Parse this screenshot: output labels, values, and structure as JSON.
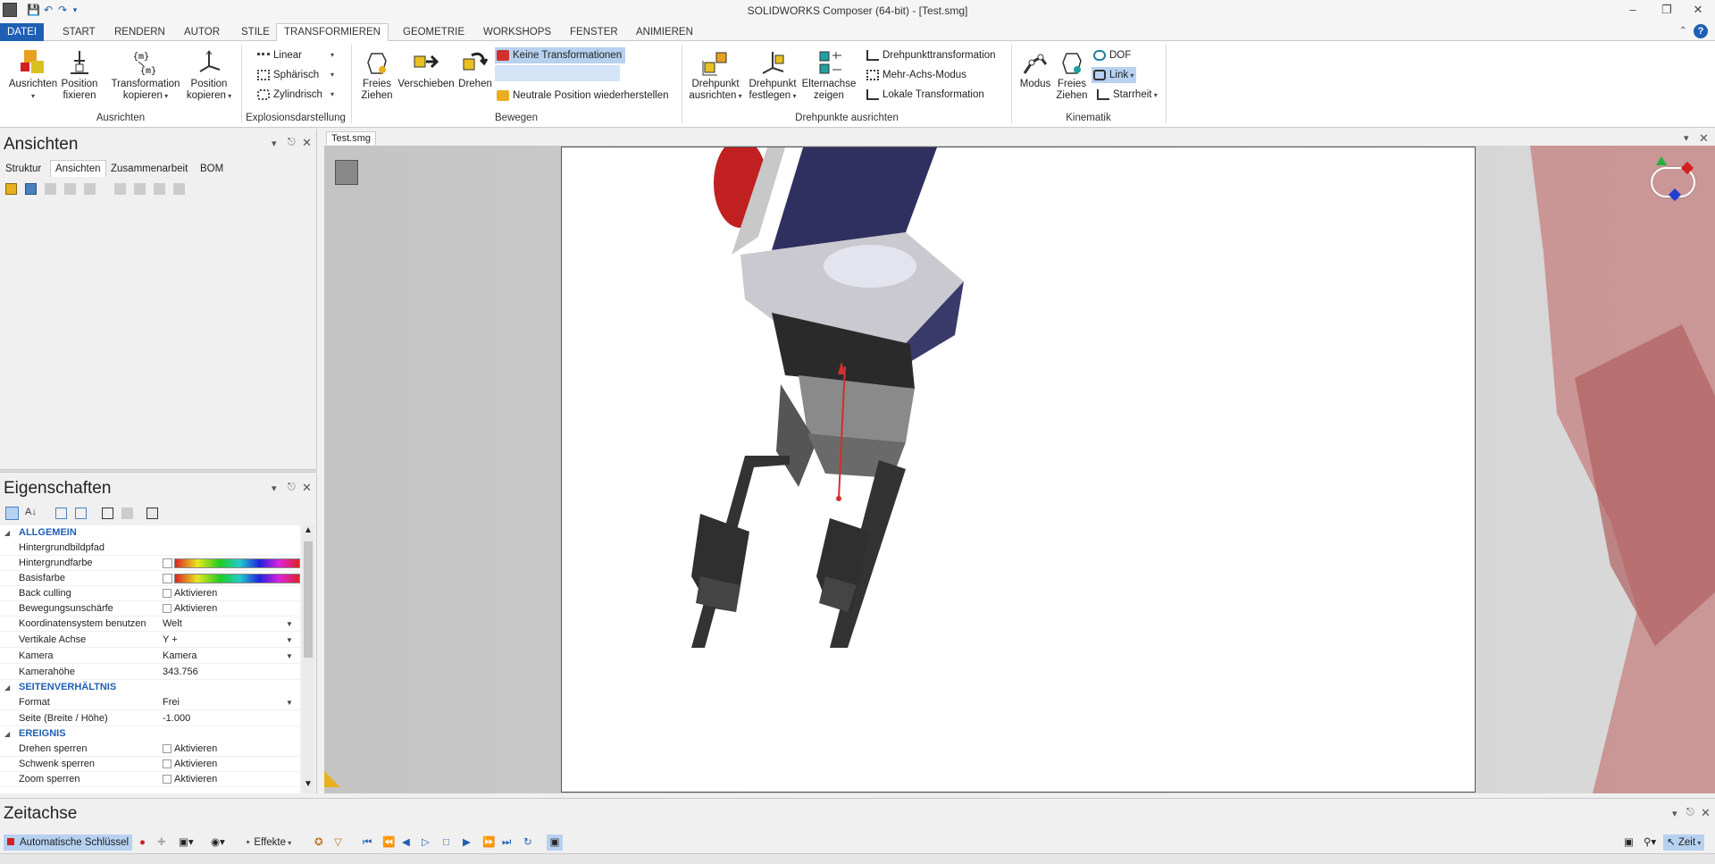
{
  "window": {
    "title": "SOLIDWORKS Composer (64-bit) - [Test.smg]"
  },
  "ribbon_tabs": [
    "DATEI",
    "START",
    "RENDERN",
    "AUTOR",
    "STILE",
    "TRANSFORMIEREN",
    "GEOMETRIE",
    "WORKSHOPS",
    "FENSTER",
    "ANIMIEREN"
  ],
  "active_tab": "TRANSFORMIEREN",
  "groups": {
    "ausrichten": {
      "label": "Ausrichten",
      "btn_ausrichten": "Ausrichten",
      "btn_position_fixieren_1": "Position",
      "btn_position_fixieren_2": "fixieren",
      "btn_transform_1": "Transformation",
      "btn_transform_2": "kopieren",
      "btn_poscopy_1": "Position",
      "btn_poscopy_2": "kopieren"
    },
    "explosion": {
      "label": "Explosionsdarstellung",
      "linear": "Linear",
      "sphaerisch": "Sphärisch",
      "zylindrisch": "Zylindrisch"
    },
    "bewegen": {
      "label": "Bewegen",
      "freies_1": "Freies",
      "freies_2": "Ziehen",
      "verschieben": "Verschieben",
      "drehen": "Drehen",
      "keine": "Keine Transformationen",
      "neutrale": "Neutrale Position wiederherstellen"
    },
    "drehpunkte": {
      "label": "Drehpunkte ausrichten",
      "ausrichten_1": "Drehpunkt",
      "ausrichten_2": "ausrichten",
      "festlegen_1": "Drehpunkt",
      "festlegen_2": "festlegen",
      "eltern_1": "Elternachse",
      "eltern_2": "zeigen",
      "dtransf": "Drehpunkttransformation",
      "mehrachs": "Mehr-Achs-Modus",
      "lokal": "Lokale Transformation"
    },
    "kinematik": {
      "label": "Kinematik",
      "modus": "Modus",
      "freies_1": "Freies",
      "freies_2": "Ziehen",
      "dof": "DOF",
      "link": "Link",
      "starrheit": "Starrheit"
    }
  },
  "views_panel": {
    "title": "Ansichten",
    "tabs": [
      "Struktur",
      "Ansichten",
      "Zusammenarbeit",
      "BOM"
    ],
    "active_tab": "Ansichten"
  },
  "properties_panel": {
    "title": "Eigenschaften",
    "sections": [
      {
        "name": "ALLGEMEIN",
        "rows": [
          {
            "label": "Hintergrundbildpfad",
            "value": ""
          },
          {
            "label": "Hintergrundfarbe",
            "value": "",
            "kind": "color"
          },
          {
            "label": "Basisfarbe",
            "value": "",
            "kind": "color"
          },
          {
            "label": "Back culling",
            "value": "Aktivieren",
            "kind": "check"
          },
          {
            "label": "Bewegungsunschärfe",
            "value": "Aktivieren",
            "kind": "check"
          },
          {
            "label": "Koordinatensystem benutzen",
            "value": "Welt",
            "kind": "select"
          },
          {
            "label": "Vertikale Achse",
            "value": "Y +",
            "kind": "select"
          },
          {
            "label": "Kamera",
            "value": "Kamera",
            "kind": "select"
          },
          {
            "label": "Kamerahöhe",
            "value": "343.756"
          }
        ]
      },
      {
        "name": "SEITENVERHÄLTNIS",
        "rows": [
          {
            "label": "Format",
            "value": "Frei",
            "kind": "select"
          },
          {
            "label": "Seite (Breite / Höhe)",
            "value": "-1.000"
          }
        ]
      },
      {
        "name": "EREIGNIS",
        "rows": [
          {
            "label": "Drehen sperren",
            "value": "Aktivieren",
            "kind": "check"
          },
          {
            "label": "Schwenk sperren",
            "value": "Aktivieren",
            "kind": "check"
          },
          {
            "label": "Zoom sperren",
            "value": "Aktivieren",
            "kind": "check"
          }
        ]
      }
    ]
  },
  "document_tab": "Test.smg",
  "timeline": {
    "title": "Zeitachse",
    "auto_keys": "Automatische Schlüssel",
    "effects": "Effekte",
    "time": "Zeit"
  },
  "colors": {
    "accent": "#1e5fb4",
    "highlight": "#b7d1f0",
    "robot": "#c07070"
  }
}
